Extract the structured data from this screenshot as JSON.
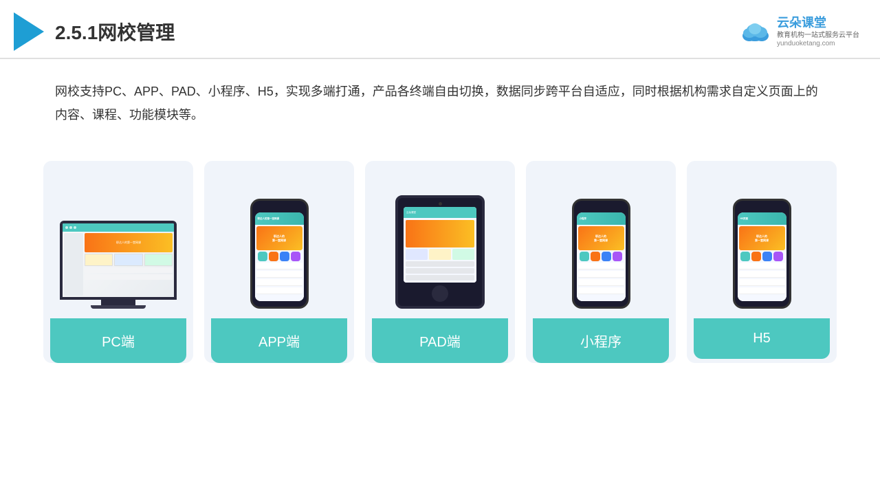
{
  "header": {
    "title": "2.5.1网校管理",
    "brand": {
      "name": "云朵课堂",
      "subtitle": "教育机构一站式服务云平台",
      "url": "yunduoketang.com"
    }
  },
  "description": "网校支持PC、APP、PAD、小程序、H5，实现多端打通，产品各终端自由切换，数据同步跨平台自适应，同时根据机构需求自定义页面上的内容、课程、功能模块等。",
  "cards": [
    {
      "id": "pc",
      "label": "PC端"
    },
    {
      "id": "app",
      "label": "APP端"
    },
    {
      "id": "pad",
      "label": "PAD端"
    },
    {
      "id": "miniprogram",
      "label": "小程序"
    },
    {
      "id": "h5",
      "label": "H5"
    }
  ],
  "colors": {
    "teal": "#4DC8C0",
    "accent_blue": "#3B9DDD",
    "triangle_blue": "#1E9ED4",
    "text_main": "#333333",
    "bg_card": "#f0f4fa"
  }
}
